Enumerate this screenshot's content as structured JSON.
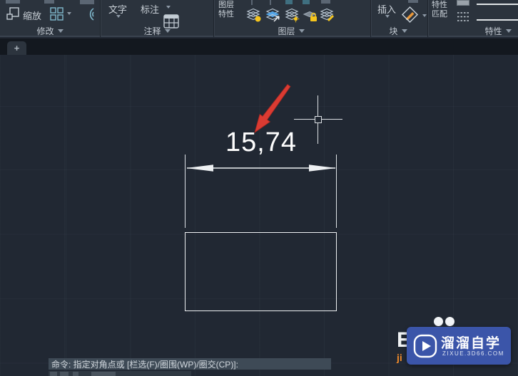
{
  "ribbon": {
    "modify": {
      "label": "修改",
      "scale_button": "缩放"
    },
    "annotate": {
      "label": "注释",
      "text_button": "文字",
      "dimension_button": "标注"
    },
    "layers": {
      "label": "图层",
      "properties_line1": "图层",
      "properties_line2": "特性"
    },
    "block": {
      "label": "块",
      "insert_button": "插入"
    },
    "properties": {
      "label": "特性",
      "match_line1": "特性",
      "match_line2": "匹配"
    }
  },
  "tabbar": {
    "new_tab_label": "+"
  },
  "drawing": {
    "dimension_value": "15,74"
  },
  "command_line": {
    "prompt": "命令: 指定对角点或 [栏选(F)/圈围(WP)/圈交(CP)]:"
  },
  "watermark": {
    "brand": "溜溜自学",
    "site": "zixue.3d66.com",
    "partial_letter": "E",
    "partial_text": "ji"
  },
  "icons": {
    "scale-icon": "two nested squares",
    "array-icon": "2x2 square grid",
    "fillet-icon": "concentric arcs",
    "table-icon": "table grid",
    "layer-on-icon": "layer stack + yellow bulb",
    "layer-match-icon": "layer stack + blue arrow",
    "layer-isolate-icon": "layer stack + yellow sun",
    "layer-lock-icon": "layer + yellow lock",
    "layer-edit-icon": "layer stack + pencil",
    "attribute-edit-icon": "diamond tag + orange pencil",
    "linetype-icon": "dashed lines",
    "play-icon": "circled play triangle",
    "crosshair-cursor": "drawing crosshair with pickbox",
    "annotation-arrow": "red callout arrow"
  },
  "colors": {
    "canvas_bg": "#212833",
    "ribbon_bg": "#2b333d",
    "entity_white": "#eef1f3",
    "annotation_red": "#da3b32",
    "watermark_blue": "#3b55a9",
    "accent_yellow": "#f5c51d",
    "accent_blue": "#54a6e8"
  }
}
